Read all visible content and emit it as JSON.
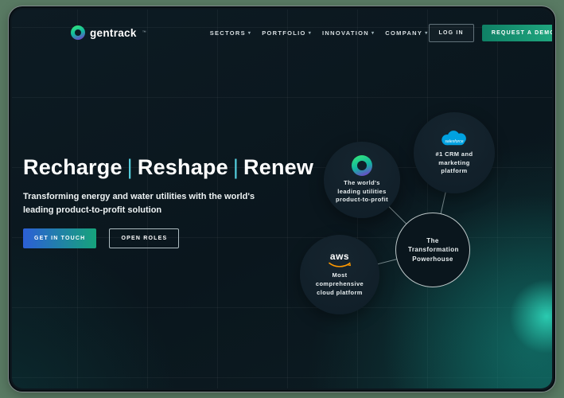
{
  "brand": {
    "name": "gentrack",
    "trademark": "™"
  },
  "nav": {
    "items": [
      {
        "label": "SECTORS"
      },
      {
        "label": "PORTFOLIO"
      },
      {
        "label": "INNOVATION"
      },
      {
        "label": "COMPANY"
      }
    ],
    "login_label": "LOG IN",
    "demo_label": "REQUEST A DEMO"
  },
  "hero": {
    "title_words": [
      "Recharge",
      "Reshape",
      "Renew"
    ],
    "separator": "|",
    "subtitle": "Transforming energy and water utilities with the world's leading product-to-profit solution",
    "primary_cta": "GET IN TOUCH",
    "secondary_cta": "OPEN ROLES"
  },
  "diagram": {
    "nodes": {
      "gentrack": {
        "label": "The world's leading utilities product-to-profit"
      },
      "salesforce": {
        "brand": "salesforce",
        "label": "#1 CRM and marketing platform"
      },
      "aws": {
        "brand": "aws",
        "label": "Most comprehensive cloud platform"
      },
      "center": {
        "label": "The Transformation Powerhouse"
      }
    }
  },
  "colors": {
    "frame_background": "#597a63",
    "screen_background": "#0b1720",
    "accent_teal": "#22ad83",
    "separator_teal": "#55cfde",
    "salesforce_blue": "#00A1E0",
    "aws_orange": "#FF9900"
  }
}
